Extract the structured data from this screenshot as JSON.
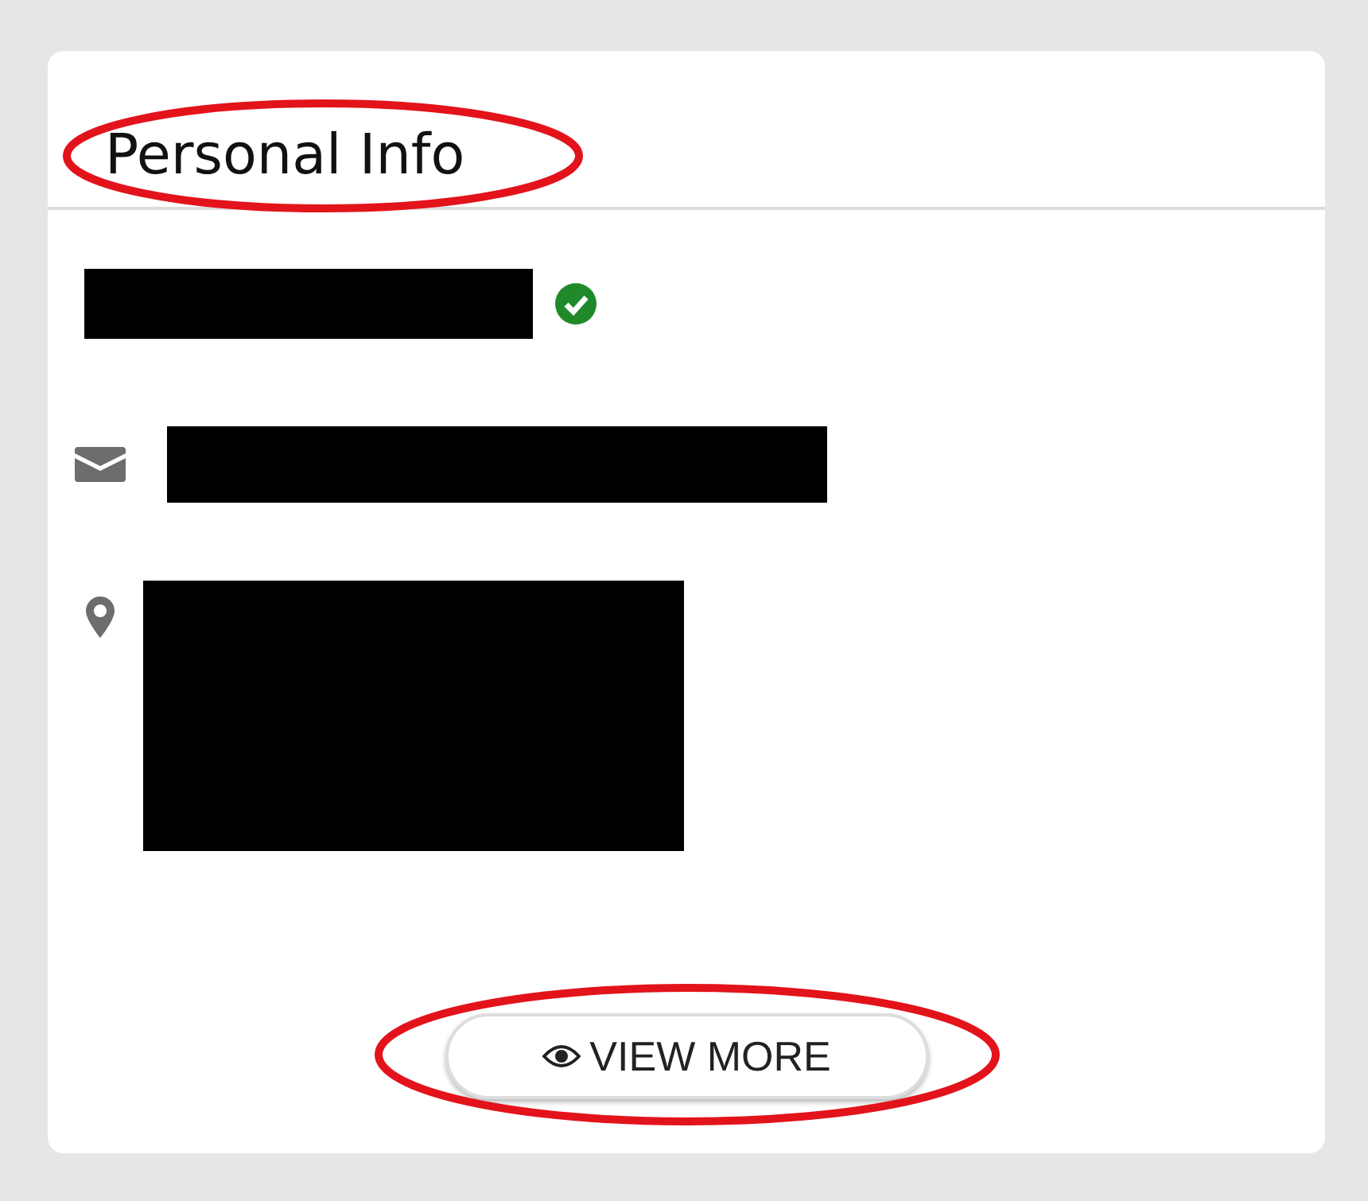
{
  "card": {
    "title": "Personal Info",
    "title_circled": true
  },
  "fields": [
    {
      "kind": "name",
      "verified": true
    },
    {
      "kind": "email",
      "verified": false
    },
    {
      "kind": "address",
      "verified": false
    }
  ],
  "button": {
    "label": "VIEW MORE",
    "circled": true
  }
}
